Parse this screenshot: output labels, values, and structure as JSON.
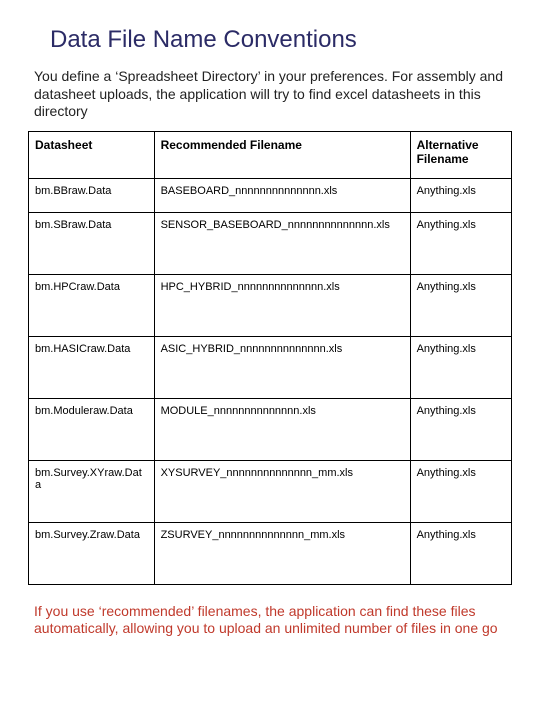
{
  "title": "Data File Name Conventions",
  "intro": "You define a ‘Spreadsheet Directory’ in your preferences. For assembly and datasheet uploads, the application will try to find excel datasheets in this  directory",
  "columns": [
    "Datasheet",
    "Recommended Filename",
    "Alternative Filename"
  ],
  "rows": [
    {
      "datasheet": "bm.BBraw.Data",
      "recommended": "BASEBOARD_nnnnnnnnnnnnnn.xls",
      "alternative": "Anything.xls"
    },
    {
      "datasheet": "bm.SBraw.Data",
      "recommended": "SENSOR_BASEBOARD_nnnnnnnnnnnnnn.xls",
      "alternative": "Anything.xls"
    },
    {
      "datasheet": "bm.HPCraw.Data",
      "recommended": "HPC_HYBRID_nnnnnnnnnnnnnn.xls",
      "alternative": "Anything.xls"
    },
    {
      "datasheet": "bm.HASICraw.Data",
      "recommended": "ASIC_HYBRID_nnnnnnnnnnnnnn.xls",
      "alternative": "Anything.xls"
    },
    {
      "datasheet": "bm.Moduleraw.Data",
      "recommended": "MODULE_nnnnnnnnnnnnnn.xls",
      "alternative": "Anything.xls"
    },
    {
      "datasheet": "bm.Survey.XYraw.Data",
      "recommended": "XYSURVEY_nnnnnnnnnnnnnn_mm.xls",
      "alternative": "Anything.xls"
    },
    {
      "datasheet": "bm.Survey.Zraw.Data",
      "recommended": "ZSURVEY_nnnnnnnnnnnnnn_mm.xls",
      "alternative": "Anything.xls"
    }
  ],
  "footer": "If you use ‘recommended’ filenames, the application can find these files automatically, allowing you to upload an unlimited number of files in one go"
}
